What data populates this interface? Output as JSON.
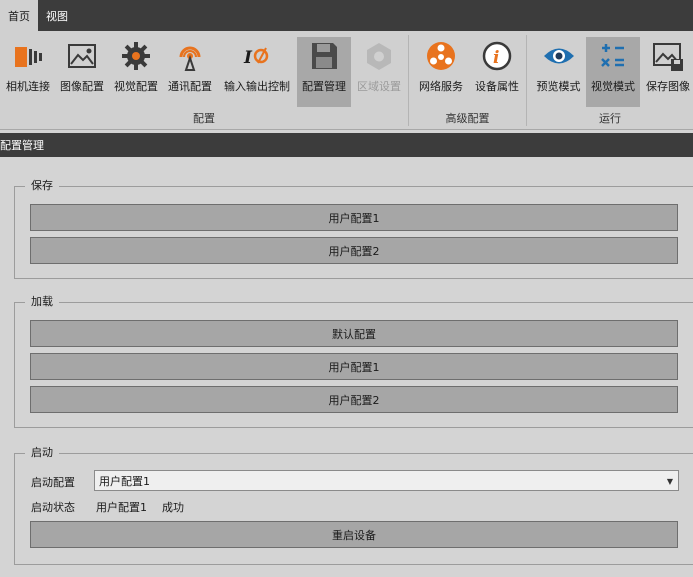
{
  "tabs": [
    {
      "label": "首页",
      "active": true
    },
    {
      "label": "视图",
      "active": false
    }
  ],
  "ribbon": {
    "groups": [
      {
        "label": "配置"
      },
      {
        "label": "高级配置"
      },
      {
        "label": "运行"
      }
    ],
    "buttons": [
      {
        "label": "相机连接",
        "icon": "camera-connect-icon"
      },
      {
        "label": "图像配置",
        "icon": "image-icon"
      },
      {
        "label": "视觉配置",
        "icon": "gear-icon"
      },
      {
        "label": "通讯配置",
        "icon": "antenna-icon"
      },
      {
        "label": "输入输出控制",
        "icon": "io-icon"
      },
      {
        "label": "配置管理",
        "icon": "floppy-icon",
        "selected": true
      },
      {
        "label": "区域设置",
        "icon": "region-icon",
        "disabled": true
      },
      {
        "label": "网络服务",
        "icon": "network-icon"
      },
      {
        "label": "设备属性",
        "icon": "info-icon"
      },
      {
        "label": "预览模式",
        "icon": "eye-icon"
      },
      {
        "label": "视觉模式",
        "icon": "calculator-icon",
        "selected": true
      },
      {
        "label": "保存图像",
        "icon": "save-image-icon"
      }
    ]
  },
  "section_title": "配置管理",
  "save_group": {
    "title": "保存",
    "buttons": [
      "用户配置1",
      "用户配置2"
    ]
  },
  "load_group": {
    "title": "加载",
    "buttons": [
      "默认配置",
      "用户配置1",
      "用户配置2"
    ]
  },
  "startup_group": {
    "title": "启动",
    "config_label": "启动配置",
    "config_value": "用户配置1",
    "status_label": "启动状态",
    "status_config": "用户配置1",
    "status_result": "成功",
    "restart_button": "重启设备"
  },
  "colors": {
    "dark_bar": "#3c3c3c",
    "orange": "#e8731e",
    "blue_icon": "#1f6fb0",
    "button_face": "#a6a6a6"
  }
}
